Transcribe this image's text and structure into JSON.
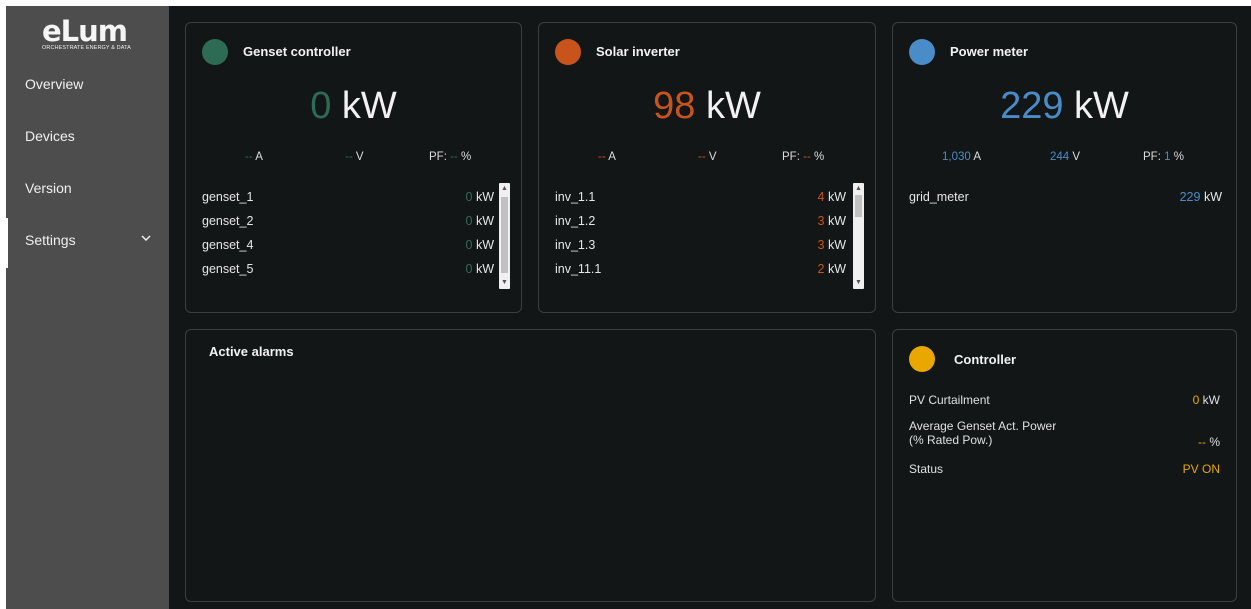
{
  "sidebar": {
    "logo_mark": "eLum",
    "logo_tagline": "ORCHESTRATE ENERGY & DATA",
    "items": [
      {
        "label": "Overview"
      },
      {
        "label": "Devices"
      },
      {
        "label": "Version"
      },
      {
        "label": "Settings"
      }
    ]
  },
  "colors": {
    "genset": "#2e6b55",
    "solar": "#c9541b",
    "meter": "#4a8cc8",
    "controller": "#e8a800",
    "genset_value": "#2e6b55",
    "solar_value": "#c9541b",
    "meter_value": "#4a8cc8",
    "controller_value": "#e8a800"
  },
  "genset": {
    "title": "Genset controller",
    "power": "0",
    "unit": "kW",
    "current": "--",
    "current_unit": "A",
    "voltage": "--",
    "voltage_unit": "V",
    "pf_label": "PF:",
    "pf": "--",
    "pf_unit": "%",
    "rows": [
      {
        "name": "genset_1",
        "value": "0",
        "unit": "kW"
      },
      {
        "name": "genset_2",
        "value": "0",
        "unit": "kW"
      },
      {
        "name": "genset_4",
        "value": "0",
        "unit": "kW"
      },
      {
        "name": "genset_5",
        "value": "0",
        "unit": "kW"
      }
    ]
  },
  "solar": {
    "title": "Solar inverter",
    "power": "98",
    "unit": "kW",
    "current": "--",
    "current_unit": "A",
    "voltage": "--",
    "voltage_unit": "V",
    "pf_label": "PF:",
    "pf": "--",
    "pf_unit": "%",
    "rows": [
      {
        "name": "inv_1.1",
        "value": "4",
        "unit": "kW"
      },
      {
        "name": "inv_1.2",
        "value": "3",
        "unit": "kW"
      },
      {
        "name": "inv_1.3",
        "value": "3",
        "unit": "kW"
      },
      {
        "name": "inv_11.1",
        "value": "2",
        "unit": "kW"
      }
    ]
  },
  "meter": {
    "title": "Power meter",
    "power": "229",
    "unit": "kW",
    "current": "1,030",
    "current_unit": "A",
    "voltage": "244",
    "voltage_unit": "V",
    "pf_label": "PF:",
    "pf": "1",
    "pf_unit": "%",
    "rows": [
      {
        "name": "grid_meter",
        "value": "229",
        "unit": "kW"
      }
    ]
  },
  "alarms": {
    "title": "Active alarms"
  },
  "controller": {
    "title": "Controller",
    "rows": [
      {
        "label": "PV Curtailment",
        "value": "0",
        "unit": "kW"
      },
      {
        "label": "Average Genset Act. Power",
        "label2": "(% Rated Pow.)",
        "value": "--",
        "unit": "%"
      },
      {
        "label": "Status",
        "value": "PV ON",
        "unit": ""
      }
    ]
  }
}
